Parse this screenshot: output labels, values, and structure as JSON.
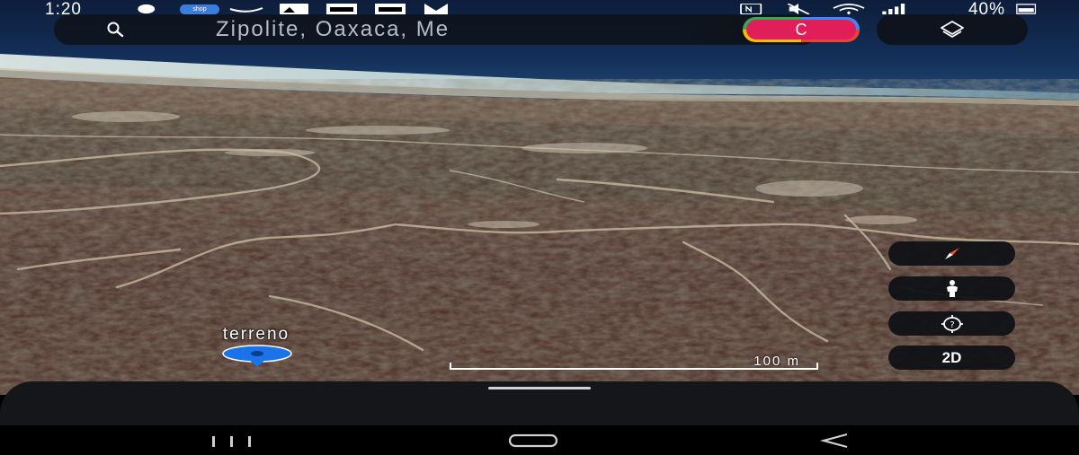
{
  "status_bar": {
    "time": "1:20",
    "battery_text": "40%",
    "notification_badge": "shop"
  },
  "search": {
    "value": "Zipolite, Oaxaca, Me",
    "account_initial": "C"
  },
  "map": {
    "place_label": "terreno",
    "scale_label": "100 m"
  },
  "controls": {
    "view_mode_label": "2D"
  },
  "icons": {
    "search": "search-icon",
    "layers": "layers-icon",
    "compass": "compass-icon",
    "street_view": "pegman-icon",
    "my_location": "my-location-icon",
    "pin": "map-pin-icon",
    "nav_recents": "recents-icon",
    "nav_home": "home-icon",
    "nav_back": "back-icon"
  },
  "colors": {
    "pin": "#1a73e8",
    "avatar": "#e01e5a",
    "compass_needle": "#e8512e"
  }
}
